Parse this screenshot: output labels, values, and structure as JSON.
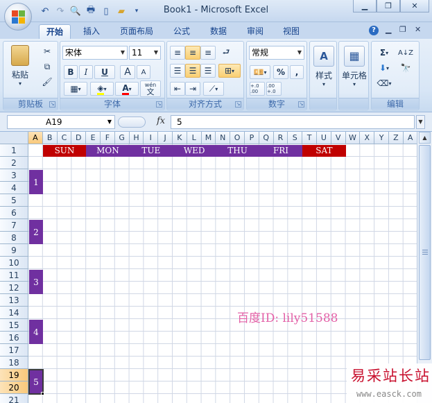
{
  "window": {
    "title": "Book1 - Microsoft Excel"
  },
  "qat_icons": [
    "undo-icon",
    "redo-icon",
    "print-preview-icon",
    "print-icon",
    "new-icon",
    "open-icon",
    "customize-icon"
  ],
  "tabs": [
    {
      "label": "开始",
      "active": true
    },
    {
      "label": "插入"
    },
    {
      "label": "页面布局"
    },
    {
      "label": "公式"
    },
    {
      "label": "数据"
    },
    {
      "label": "审阅"
    },
    {
      "label": "视图"
    }
  ],
  "ribbon": {
    "clipboard": {
      "label": "剪贴板",
      "paste": "粘贴"
    },
    "font": {
      "label": "字体",
      "name": "宋体",
      "size": "11",
      "bold": "B",
      "italic": "I",
      "underline": "U",
      "grow": "A",
      "shrink": "A",
      "wen": "wén",
      "wen_char": "文"
    },
    "align": {
      "label": "对齐方式"
    },
    "number": {
      "label": "数字",
      "format": "常规",
      "percent": "%",
      "comma": ",",
      "inc_decimal": "+.0 .00",
      "dec_decimal": ".00 +.0"
    },
    "styles": {
      "label": "样式"
    },
    "cells": {
      "label": "单元格"
    },
    "editing": {
      "label": "编辑"
    }
  },
  "formula_bar": {
    "cell_ref": "A19",
    "fx": "fx",
    "value": "5"
  },
  "columns": [
    "A",
    "B",
    "C",
    "D",
    "E",
    "F",
    "G",
    "H",
    "I",
    "J",
    "K",
    "L",
    "M",
    "N",
    "O",
    "P",
    "Q",
    "R",
    "S",
    "T",
    "U",
    "V",
    "W",
    "X",
    "Y",
    "Z",
    "A"
  ],
  "rows": [
    "1",
    "2",
    "3",
    "4",
    "5",
    "6",
    "7",
    "8",
    "9",
    "10",
    "11",
    "12",
    "13",
    "14",
    "15",
    "16",
    "17",
    "18",
    "19",
    "20",
    "21"
  ],
  "days": [
    {
      "label": "SUN",
      "color": "#c00000"
    },
    {
      "label": "MON",
      "color": "#7030a0"
    },
    {
      "label": "TUE",
      "color": "#7030a0"
    },
    {
      "label": "WED",
      "color": "#7030a0"
    },
    {
      "label": "THU",
      "color": "#7030a0"
    },
    {
      "label": "FRI",
      "color": "#7030a0"
    },
    {
      "label": "SAT",
      "color": "#c00000"
    }
  ],
  "weeks": [
    "1",
    "2",
    "3",
    "4",
    "5"
  ],
  "selected": {
    "column": "A",
    "rows": [
      "19",
      "20"
    ]
  },
  "watermark": "百度ID: lily51588",
  "brand": {
    "name": "易采站长站",
    "url": "www.easck.com"
  },
  "colors": {
    "week_fill": "#7030a0",
    "weekend_fill": "#c00000",
    "weekday_fill": "#7030a0"
  }
}
